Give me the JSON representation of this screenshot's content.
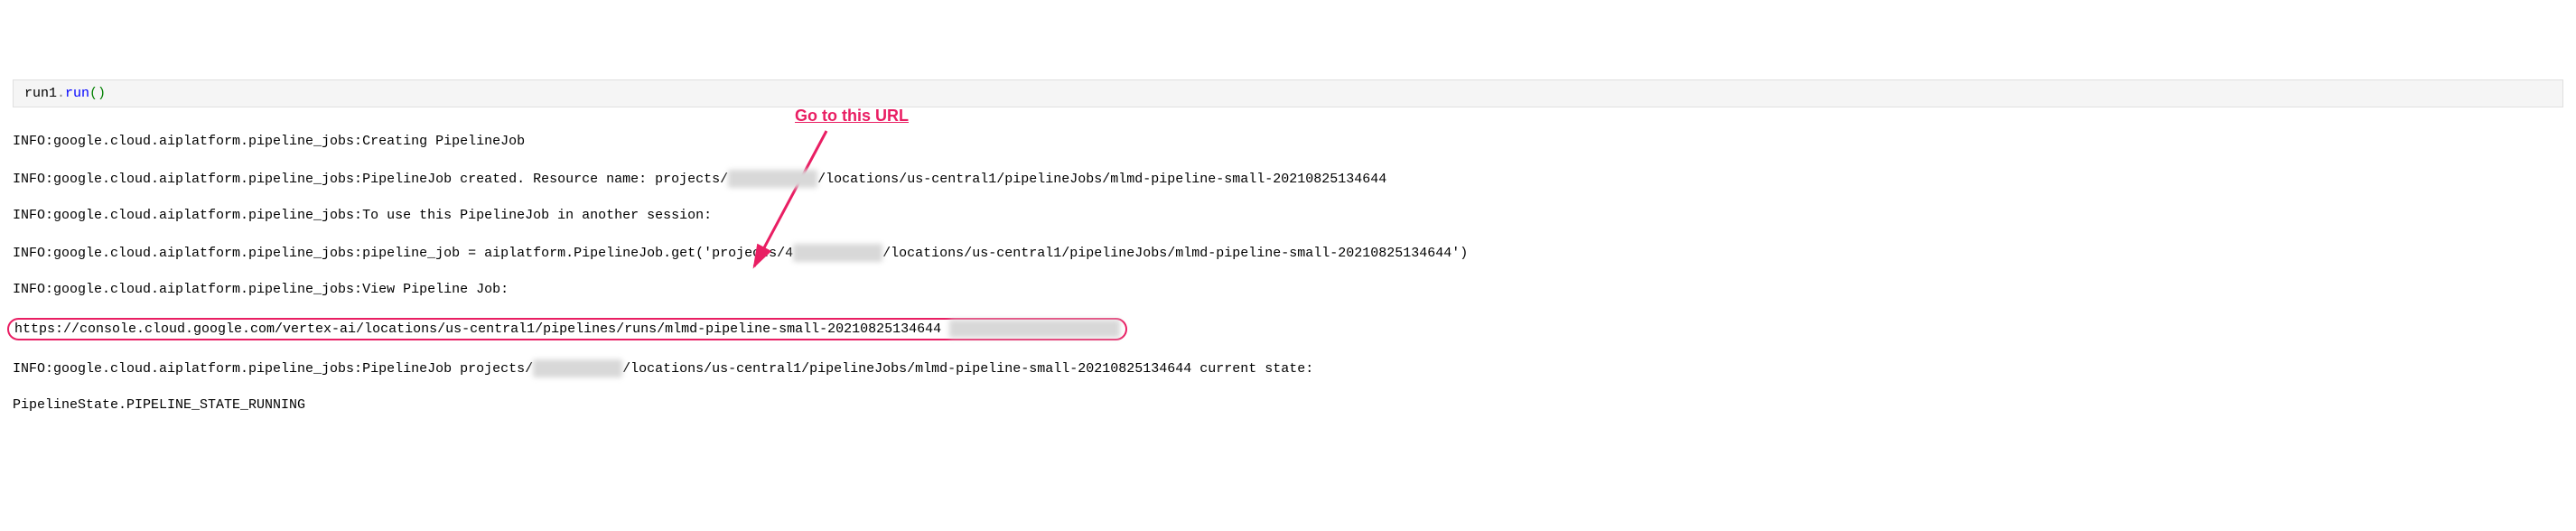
{
  "annotation": {
    "label": "Go to this URL"
  },
  "code": {
    "object": "run1",
    "dot": ".",
    "method": "run",
    "parens": "()"
  },
  "output": {
    "line1": "INFO:google.cloud.aiplatform.pipeline_jobs:Creating PipelineJob",
    "line2_pre": "INFO:google.cloud.aiplatform.pipeline_jobs:PipelineJob created. Resource name: projects/",
    "line2_redacted": "XXXXXXXXXXX",
    "line2_post": "/locations/us-central1/pipelineJobs/mlmd-pipeline-small-20210825134644",
    "line3": "INFO:google.cloud.aiplatform.pipeline_jobs:To use this PipelineJob in another session:",
    "line4_pre": "INFO:google.cloud.aiplatform.pipeline_jobs:pipeline_job = aiplatform.PipelineJob.get('projects/4",
    "line4_redacted": "XXXXXXXXXXX",
    "line4_post": "/locations/us-central1/pipelineJobs/mlmd-pipeline-small-20210825134644')",
    "line5": "INFO:google.cloud.aiplatform.pipeline_jobs:View Pipeline Job:",
    "line6_url": "https://console.cloud.google.com/vertex-ai/locations/us-central1/pipelines/runs/mlmd-pipeline-small-20210825134644",
    "line6_redacted": "XXXXXXXXXXXXXXXXXXXXX",
    "line7_pre": "INFO:google.cloud.aiplatform.pipeline_jobs:PipelineJob projects/",
    "line7_redacted": "XXXXXXXXXXX",
    "line7_post": "/locations/us-central1/pipelineJobs/mlmd-pipeline-small-20210825134644 current state:",
    "line8": "PipelineState.PIPELINE_STATE_RUNNING"
  }
}
